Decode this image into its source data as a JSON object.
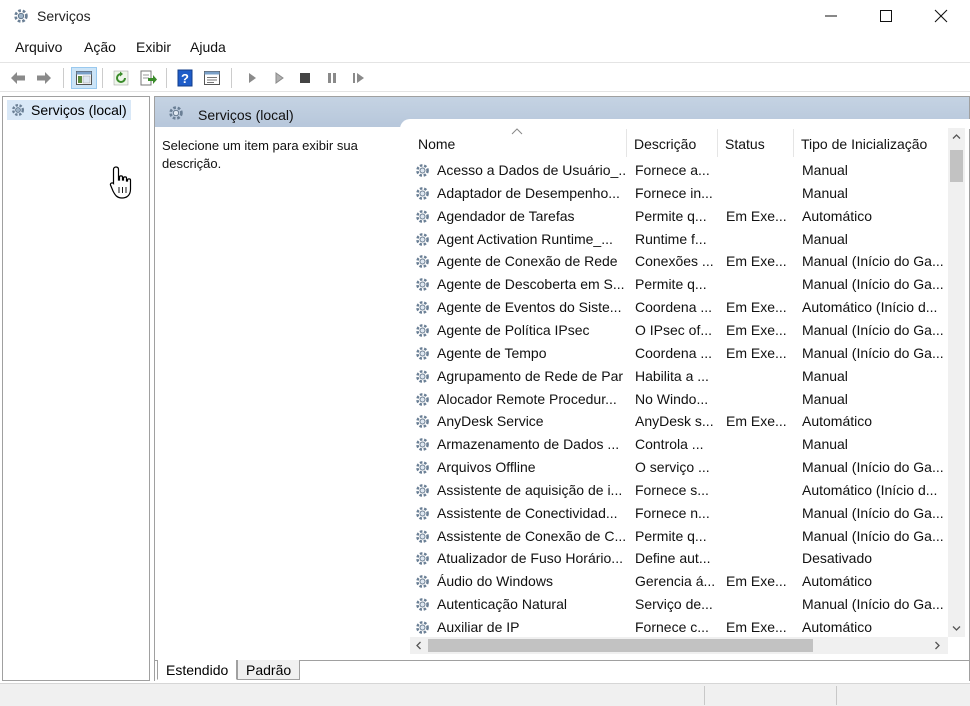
{
  "window": {
    "title": "Serviços"
  },
  "menu": [
    "Arquivo",
    "Ação",
    "Exibir",
    "Ajuda"
  ],
  "tree": {
    "root_label": "Serviços (local)"
  },
  "pane": {
    "header": "Serviços (local)",
    "description_hint": "Selecione um item para exibir sua descrição."
  },
  "columns": [
    "Nome",
    "Descrição",
    "Status",
    "Tipo de Inicialização"
  ],
  "services": [
    {
      "name": "Acesso a Dados de Usuário_...",
      "desc": "Fornece a...",
      "status": "",
      "type": "Manual"
    },
    {
      "name": "Adaptador de Desempenho...",
      "desc": "Fornece in...",
      "status": "",
      "type": "Manual"
    },
    {
      "name": "Agendador de Tarefas",
      "desc": "Permite q...",
      "status": "Em Exe...",
      "type": "Automático"
    },
    {
      "name": "Agent Activation Runtime_...",
      "desc": "Runtime f...",
      "status": "",
      "type": "Manual"
    },
    {
      "name": "Agente de Conexão de Rede",
      "desc": "Conexões ...",
      "status": "Em Exe...",
      "type": "Manual (Início do Ga..."
    },
    {
      "name": "Agente de Descoberta em S...",
      "desc": "Permite q...",
      "status": "",
      "type": "Manual (Início do Ga..."
    },
    {
      "name": "Agente de Eventos do Siste...",
      "desc": "Coordena ...",
      "status": "Em Exe...",
      "type": "Automático (Início d..."
    },
    {
      "name": "Agente de Política IPsec",
      "desc": "O IPsec of...",
      "status": "Em Exe...",
      "type": "Manual (Início do Ga..."
    },
    {
      "name": "Agente de Tempo",
      "desc": "Coordena ...",
      "status": "Em Exe...",
      "type": "Manual (Início do Ga..."
    },
    {
      "name": "Agrupamento de Rede de Par",
      "desc": "Habilita a ...",
      "status": "",
      "type": "Manual"
    },
    {
      "name": "Alocador Remote Procedur...",
      "desc": "No Windo...",
      "status": "",
      "type": "Manual"
    },
    {
      "name": "AnyDesk Service",
      "desc": "AnyDesk s...",
      "status": "Em Exe...",
      "type": "Automático"
    },
    {
      "name": "Armazenamento de Dados ...",
      "desc": "Controla ...",
      "status": "",
      "type": "Manual"
    },
    {
      "name": "Arquivos Offline",
      "desc": "O serviço ...",
      "status": "",
      "type": "Manual (Início do Ga..."
    },
    {
      "name": "Assistente de aquisição de i...",
      "desc": "Fornece s...",
      "status": "",
      "type": "Automático (Início d..."
    },
    {
      "name": "Assistente de Conectividad...",
      "desc": "Fornece n...",
      "status": "",
      "type": "Manual (Início do Ga..."
    },
    {
      "name": "Assistente de Conexão de C...",
      "desc": "Permite q...",
      "status": "",
      "type": "Manual (Início do Ga..."
    },
    {
      "name": "Atualizador de Fuso Horário...",
      "desc": "Define aut...",
      "status": "",
      "type": "Desativado"
    },
    {
      "name": "Áudio do Windows",
      "desc": "Gerencia á...",
      "status": "Em Exe...",
      "type": "Automático"
    },
    {
      "name": "Autenticação Natural",
      "desc": "Serviço de...",
      "status": "",
      "type": "Manual (Início do Ga..."
    },
    {
      "name": "Auxiliar de IP",
      "desc": "Fornece c...",
      "status": "Em Exe...",
      "type": "Automático"
    }
  ],
  "tabs": [
    "Estendido",
    "Padrão"
  ],
  "icons": {
    "app": "gear-icon",
    "back": "arrow-left-icon",
    "forward": "arrow-right-icon",
    "console_tree": "console-tree-icon",
    "refresh": "refresh-icon",
    "export": "export-list-icon",
    "help": "help-icon",
    "properties": "properties-icon",
    "start": "play-icon",
    "start_alt": "play-outline-icon",
    "stop": "stop-icon",
    "pause": "pause-icon",
    "restart": "restart-icon"
  },
  "colors": {
    "header_bg": "#b7c7db",
    "selected_tree": "#d9e8f7",
    "help_blue": "#1e5cc8"
  }
}
